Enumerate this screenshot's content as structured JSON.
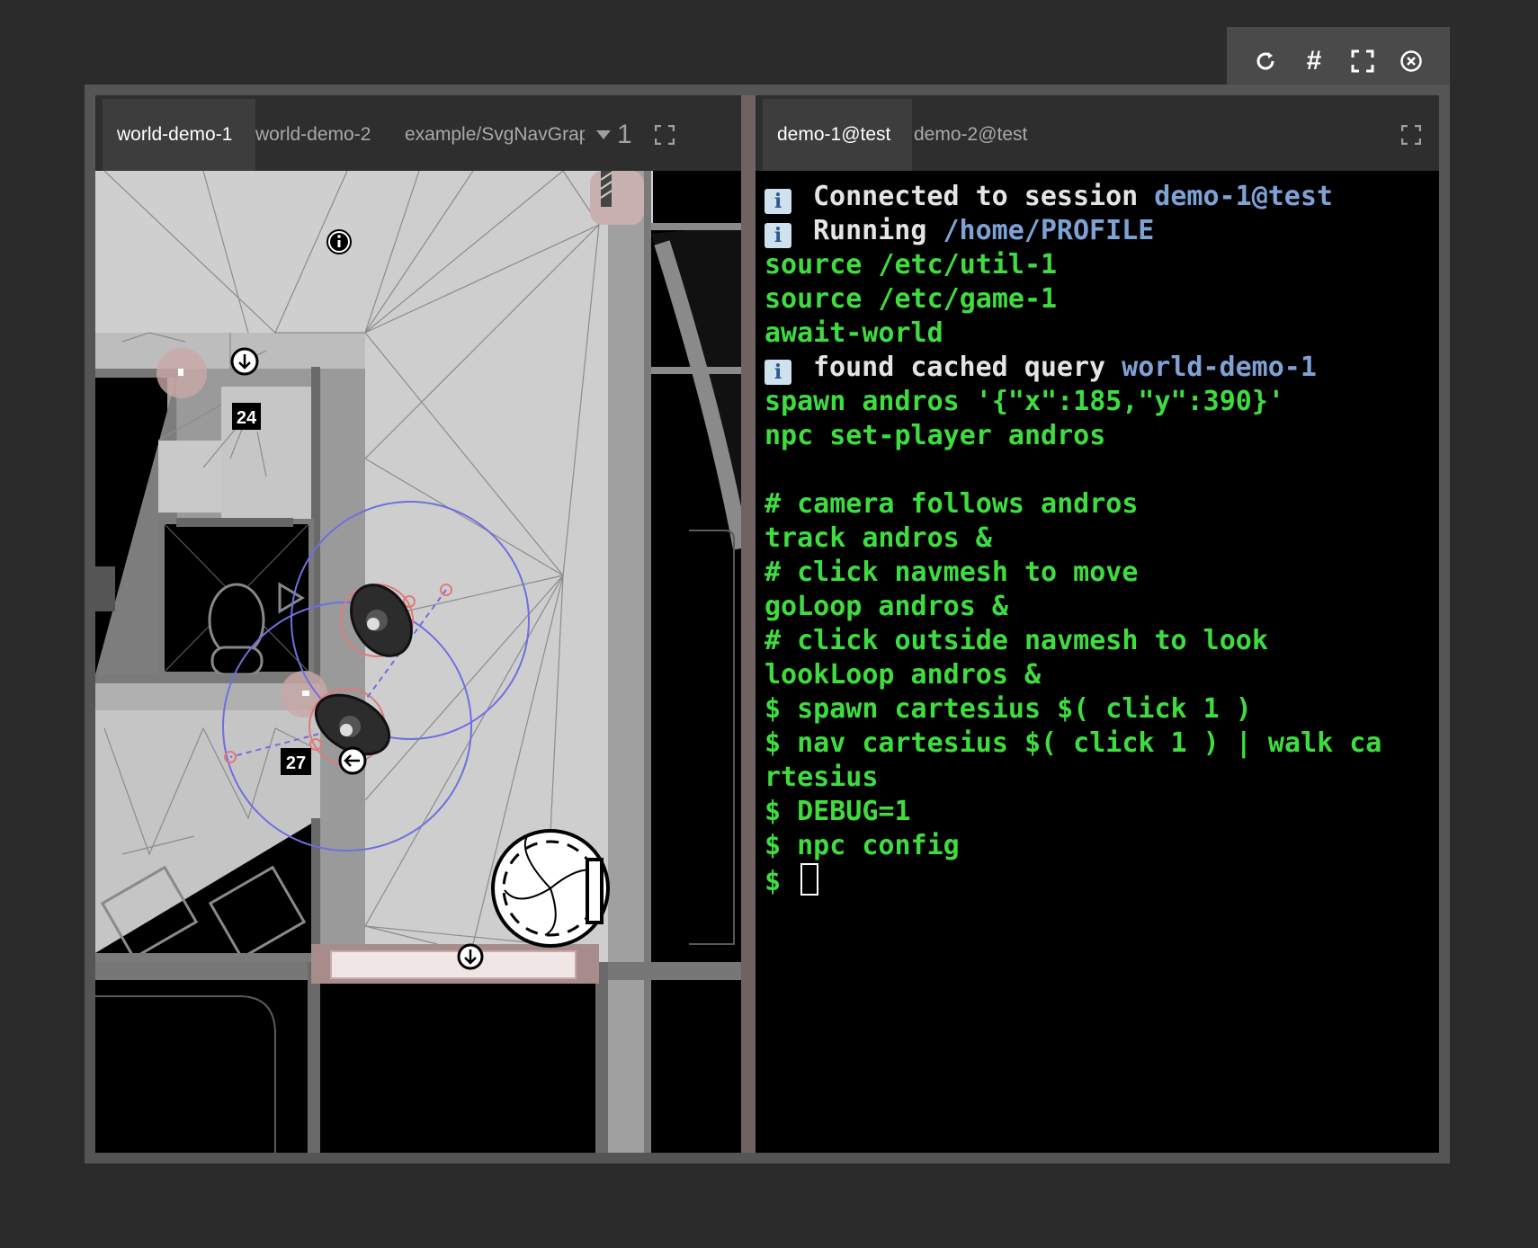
{
  "toolbar": {
    "icons": [
      "refresh-icon",
      "grid-hash-icon",
      "fullscreen-icon",
      "close-circle-icon"
    ],
    "hash_label": "#"
  },
  "left_tabs": {
    "tabs": [
      "world-demo-1",
      "world-demo-2",
      "example/SvgNavGraph"
    ],
    "active": 0,
    "overflow_count": "1"
  },
  "world": {
    "labels": [
      "24",
      "27"
    ]
  },
  "right_tabs": {
    "tabs": [
      "demo-1@test",
      "demo-2@test"
    ],
    "active": 0
  },
  "terminal": {
    "lines": [
      {
        "info": true,
        "text": "Connected to session ",
        "highlight": "demo-1@test"
      },
      {
        "info": true,
        "text": "Running ",
        "highlight": "/home/PROFILE"
      },
      {
        "text": "source /etc/util-1"
      },
      {
        "text": "source /etc/game-1"
      },
      {
        "text": "await-world"
      },
      {
        "info": true,
        "text": "found cached query ",
        "highlight": "world-demo-1"
      },
      {
        "text": "spawn andros '{\"x\":185,\"y\":390}'"
      },
      {
        "text": "npc set-player andros"
      },
      {
        "text": ""
      },
      {
        "text": "# camera follows andros"
      },
      {
        "text": "track andros &"
      },
      {
        "text": "# click navmesh to move"
      },
      {
        "text": "goLoop andros &"
      },
      {
        "text": "# click outside navmesh to look"
      },
      {
        "text": "lookLoop andros &"
      },
      {
        "text": "$ spawn cartesius $( click 1 )"
      },
      {
        "text": "$ nav cartesius $( click 1 ) | walk ca"
      },
      {
        "text": "rtesius"
      },
      {
        "text": "$ DEBUG=1"
      },
      {
        "text": "$ npc config"
      },
      {
        "text": "$ ",
        "cursor": true
      }
    ]
  }
}
